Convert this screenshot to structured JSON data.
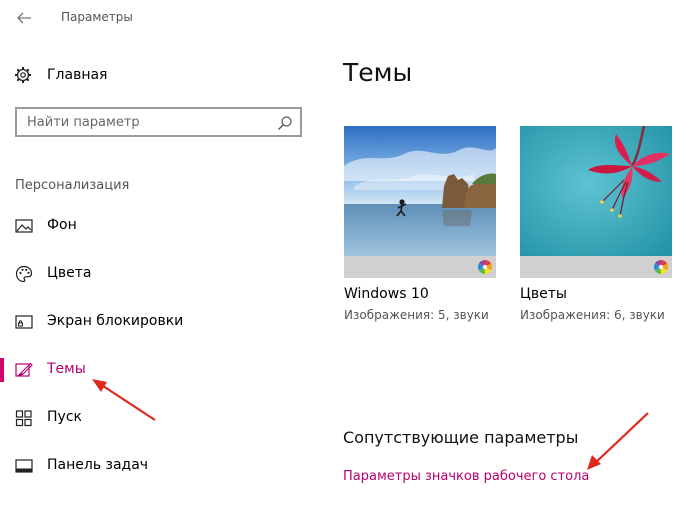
{
  "window": {
    "title": "Параметры"
  },
  "sidebar": {
    "home_label": "Главная",
    "search_placeholder": "Найти параметр",
    "section_label": "Персонализация",
    "items": [
      {
        "label": "Фон",
        "icon": "picture-icon"
      },
      {
        "label": "Цвета",
        "icon": "palette-icon"
      },
      {
        "label": "Экран блокировки",
        "icon": "lock-screen-icon"
      },
      {
        "label": "Темы",
        "icon": "themes-icon",
        "active": true
      },
      {
        "label": "Пуск",
        "icon": "start-icon"
      },
      {
        "label": "Панель задач",
        "icon": "taskbar-icon"
      }
    ]
  },
  "main": {
    "title": "Темы",
    "themes": [
      {
        "name": "Windows 10",
        "description": "Изображения: 5, звуки"
      },
      {
        "name": "Цветы",
        "description": "Изображения: 6, звуки"
      }
    ],
    "related_title": "Сопутствующие параметры",
    "related_link": "Параметры значков рабочего стола"
  },
  "colors": {
    "accent": "#b5006e",
    "accent_bar": "#d4006b",
    "annotation_arrow": "#e0281e"
  }
}
